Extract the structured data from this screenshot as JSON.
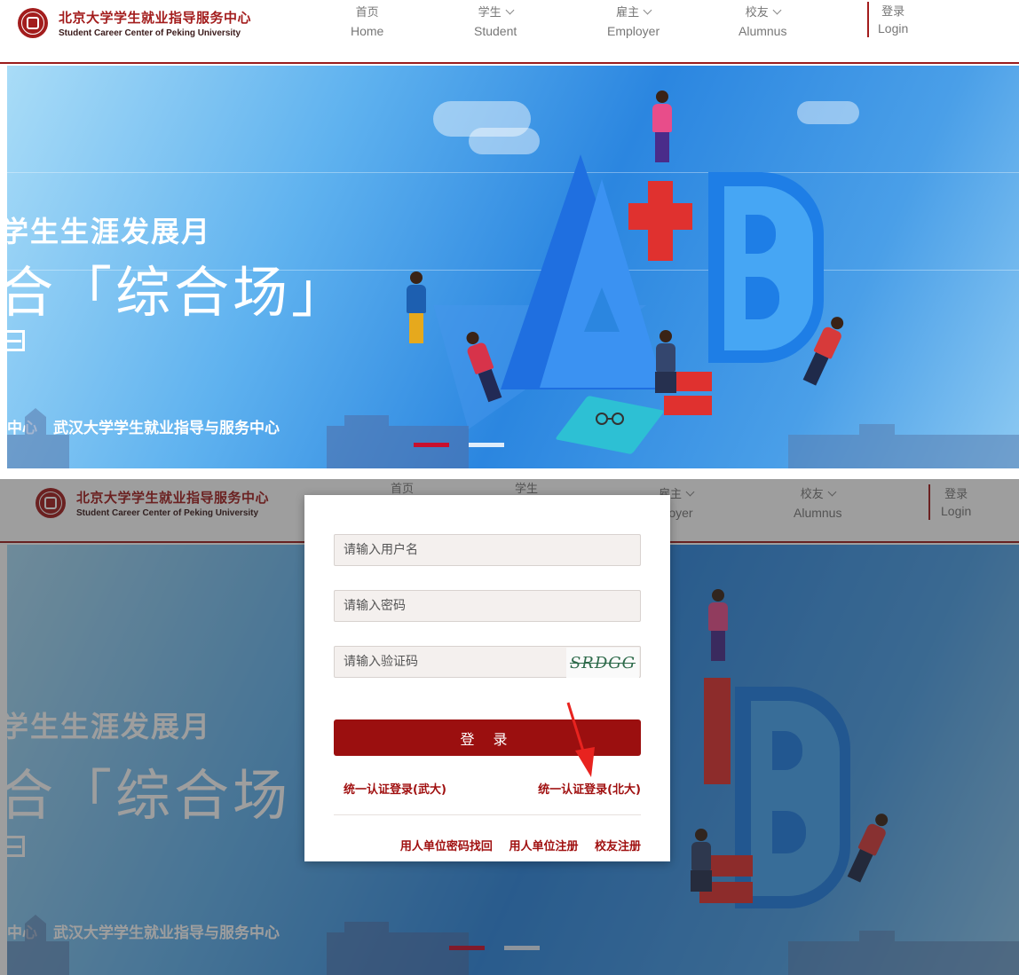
{
  "header": {
    "org_name_cn": "北京大学学生就业指导服务中心",
    "org_name_en": "Student Career Center of Peking University",
    "nav": [
      {
        "cn": "首页",
        "en": "Home"
      },
      {
        "cn": "学生",
        "en": "Student"
      },
      {
        "cn": "雇主",
        "en": "Employer"
      },
      {
        "cn": "校友",
        "en": "Alumnus"
      }
    ],
    "login_cn": "登录",
    "login_en": "Login",
    "bottom_visible": {
      "nav_cn_0": "首页",
      "nav_cn_1": "学生",
      "nav_cn_2": "雇主",
      "employer_en_fragment": "ployer",
      "nav_cn_3": "校友",
      "nav_en_3": "Alumnus"
    }
  },
  "banner": {
    "line1": "学生生涯发展月",
    "line2": "合「综合场」",
    "org_fragment": "中心",
    "org_full": "武汉大学学生就业指导与服务中心",
    "line2_bottom": "合「综合场",
    "colors": {
      "sky_light": "#a9dcf7",
      "sky_deep": "#2b86e0",
      "accent_red": "#e0312f"
    }
  },
  "login_modal": {
    "username_placeholder": "请输入用户名",
    "password_placeholder": "请输入密码",
    "captcha_placeholder": "请输入验证码",
    "captcha_text": "SRDGG",
    "login_button": "登 录",
    "sso_whu": "统一认证登录(武大)",
    "sso_pku": "统一认证登录(北大)",
    "links": [
      "用人单位密码找回",
      "用人单位注册",
      "校友注册"
    ]
  },
  "colors": {
    "brand_red": "#9b0f0f",
    "header_border": "#9b1c1c"
  }
}
